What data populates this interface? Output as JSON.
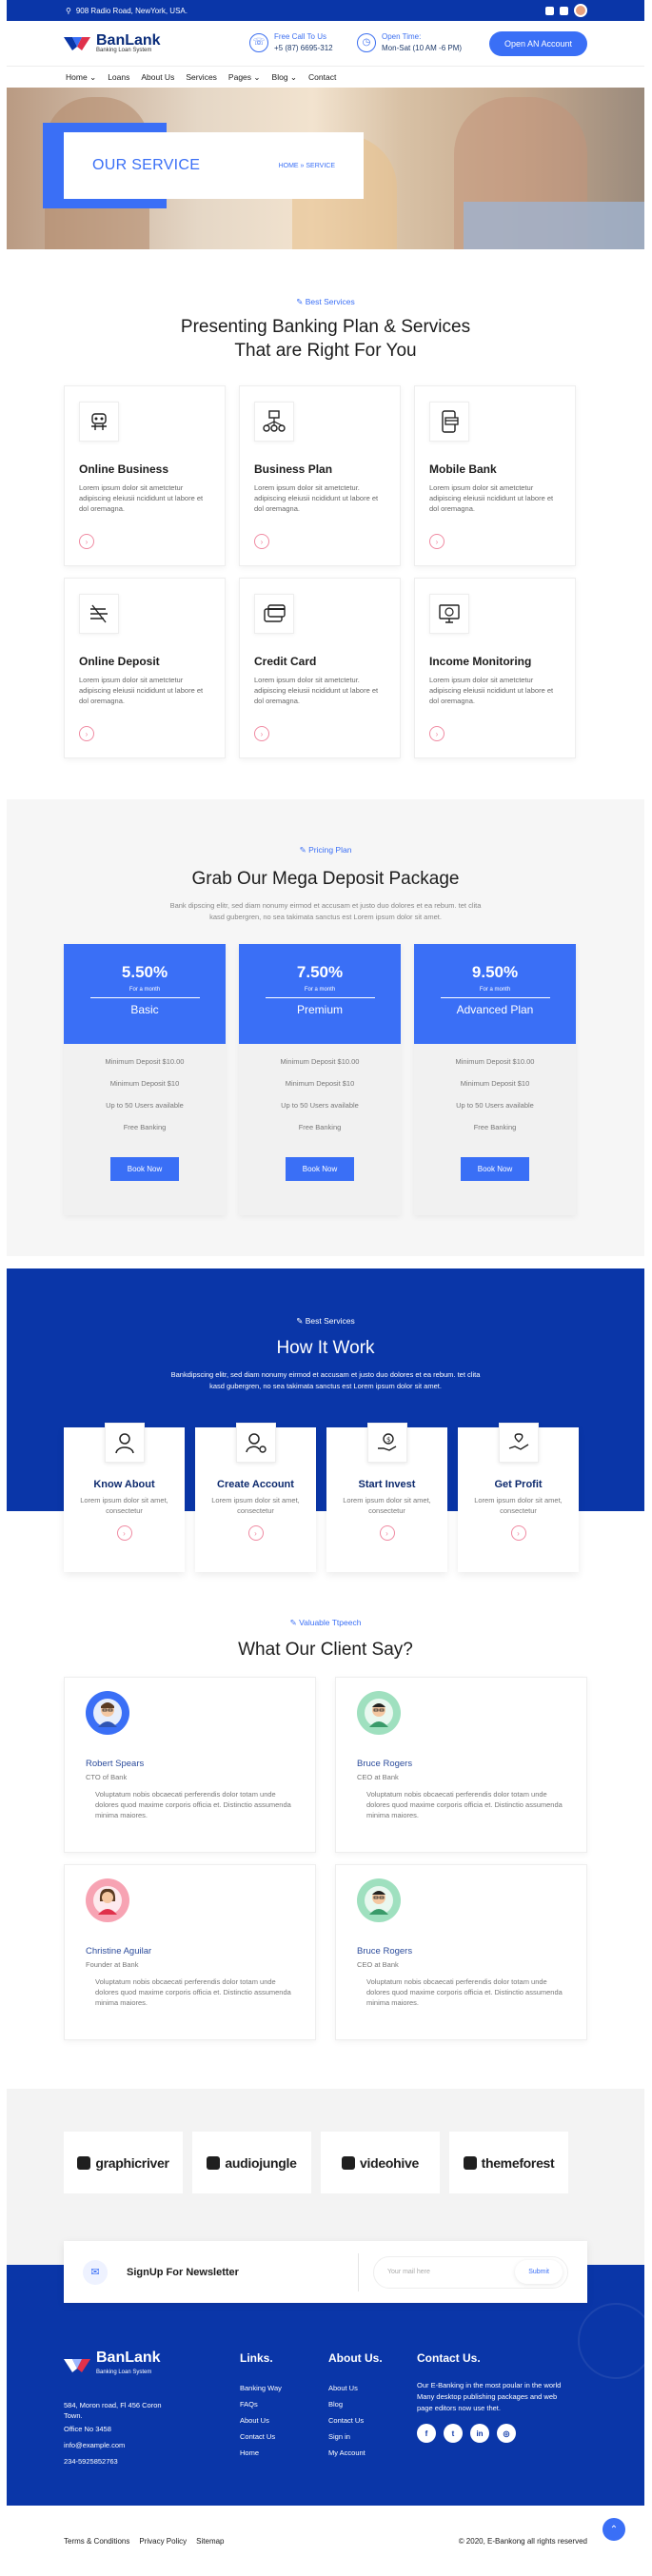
{
  "topbar": {
    "address": "908 Radio Road, NewYork, USA."
  },
  "brand": {
    "name": "BanLank",
    "tagline": "Banking Loan System"
  },
  "header": {
    "call_label": "Free Call To Us",
    "call_value": "+5 (87) 6695-312",
    "time_label": "Open Time:",
    "time_value": "Mon-Sat (10 AM -6 PM)",
    "cta": "Open AN Account"
  },
  "nav": {
    "items": [
      "Home",
      "Loans",
      "About Us",
      "Services",
      "Pages",
      "Blog",
      "Contact"
    ]
  },
  "hero": {
    "title": "OUR SERVICE",
    "crumb_home": "HOME",
    "crumb_sep": "»",
    "crumb_current": "SERVICE"
  },
  "services": {
    "tag": "Best Services",
    "title_line1": "Presenting Banking Plan & Services",
    "title_line2": "That are Right For You",
    "items": [
      {
        "title": "Online Business",
        "text": "Lorem ipsum dolor sit ametctetur adipiscing eleiusii ncididunt ut labore et dol oremagna.",
        "icon": "robot-icon"
      },
      {
        "title": "Business Plan",
        "text": "Lorem ipsum dolor sit ametctetur. adipiscing eleiusii ncididunt ut labore et dol oremagna.",
        "icon": "network-icon"
      },
      {
        "title": "Mobile Bank",
        "text": "Lorem ipsum dolor sit ametctetur adipiscing eleiusii ncididunt ut labore et dol oremagna.",
        "icon": "mobile-card-icon"
      },
      {
        "title": "Online Deposit",
        "text": "Lorem ipsum dolor sit ametctetur adipiscing eleiusii ncididunt ut labore et dol oremagna.",
        "icon": "deposit-icon"
      },
      {
        "title": "Credit Card",
        "text": "Lorem ipsum dolor sit ametctetur. adipiscing eleiusii ncididunt ut labore et dol oremagna.",
        "icon": "credit-card-icon"
      },
      {
        "title": "Income Monitoring",
        "text": "Lorem ipsum dolor sit ametctetur adipiscing eleiusii ncididunt ut labore et dol oremagna.",
        "icon": "monitor-dollar-icon"
      }
    ]
  },
  "pricing": {
    "tag": "Pricing Plan",
    "title": "Grab Our Mega Deposit Package",
    "desc_line1": "Bank dipscing elitr, sed diam nonumy eirmod et accusam et justo duo dolores et ea rebum. tet clita",
    "desc_line2": "kasd gubergren, no sea takimata sanctus est Lorem ipsum dolor sit amet.",
    "plans": [
      {
        "rate": "5.50%",
        "per": "For a month",
        "name": "Basic",
        "features": [
          "Minimum Deposit $10.00",
          "Minimum Deposit $10",
          "Up to 50 Users available",
          "Free Banking"
        ],
        "button": "Book Now"
      },
      {
        "rate": "7.50%",
        "per": "For a month",
        "name": "Premium",
        "features": [
          "Minimum Deposit $10.00",
          "Minimum Deposit $10",
          "Up to 50 Users available",
          "Free Banking"
        ],
        "button": "Book Now"
      },
      {
        "rate": "9.50%",
        "per": "For a month",
        "name": "Advanced Plan",
        "features": [
          "Minimum Deposit $10.00",
          "Minimum Deposit $10",
          "Up to 50 Users available",
          "Free Banking"
        ],
        "button": "Book Now"
      }
    ]
  },
  "how": {
    "tag": "Best Services",
    "title": "How It Work",
    "desc_line1": "Bankdipscing elitr, sed diam nonumy eirmod et accusam et justo duo dolores et ea rebum. tet clita",
    "desc_line2": "kasd gubergren, no sea takimata sanctus est Lorem ipsum dolor sit amet.",
    "steps": [
      {
        "title": "Know About",
        "text": "Lorem ipsum dolor sit amet, consectetur"
      },
      {
        "title": "Create Account",
        "text": "Lorem ipsum dolor sit amet, consectetur"
      },
      {
        "title": "Start Invest",
        "text": "Lorem ipsum dolor sit amet, consectetur"
      },
      {
        "title": "Get Profit",
        "text": "Lorem ipsum dolor sit amet, consectetur"
      }
    ]
  },
  "testimonials": {
    "tag": "Valuable Ttpeech",
    "title": "What Our Client Say?",
    "items": [
      {
        "name": "Robert Spears",
        "role": "CTO of Bank",
        "text": "Voluptatum nobis obcaecati perferendis dolor totam unde dolores quod maxime corporis officia et. Distinctio assumenda minima maiores."
      },
      {
        "name": "Bruce Rogers",
        "role": "CEO at Bank",
        "text": "Voluptatum nobis obcaecati perferendis dolor totam unde dolores quod maxime corporis officia et. Distinctio assumenda minima maiores."
      },
      {
        "name": "Christine Aguilar",
        "role": "Founder at Bank",
        "text": "Voluptatum nobis obcaecati perferendis dolor totam unde dolores quod maxime corporis officia et. Distinctio assumenda minima maiores."
      },
      {
        "name": "Bruce Rogers",
        "role": "CEO at Bank",
        "text": "Voluptatum nobis obcaecati perferendis dolor totam unde dolores quod maxime corporis officia et. Distinctio assumenda minima maiores."
      }
    ]
  },
  "partners": [
    "graphicriver",
    "audiojungle",
    "videohive",
    "themeforest"
  ],
  "newsletter": {
    "title": "SignUp For Newsletter",
    "placeholder": "Your mail here",
    "button": "Submit"
  },
  "footer": {
    "address_line1": "584, Moron road, Fl 456 Coron",
    "address_line2": "Town.",
    "office": "Office No 3458",
    "email": "info@example.com",
    "phone": "234-5925852763",
    "links_title": "Links.",
    "links": [
      "Banking Way",
      "FAQs",
      "About Us",
      "Contact Us",
      "Home"
    ],
    "about_title": "About Us.",
    "about_links": [
      "About Us",
      "Blog",
      "Contact Us",
      "Sign in",
      "My Account"
    ],
    "contact_title": "Contact Us.",
    "contact_text_1": "Our E-Banking in the most poular in the world",
    "contact_text_2": "Many desktop publishing packages and web",
    "contact_text_3": "page editors now use thet.",
    "social": [
      "f",
      "t",
      "in",
      "◎"
    ]
  },
  "bottom": {
    "links": [
      "Terms & Conditions",
      "Privacy Policy",
      "Sitemap"
    ],
    "copyright": "© 2020, E-Bankong all rights reserved"
  },
  "colors": {
    "primary": "#3a6ff6",
    "navy": "#0a36a8",
    "accent_pink": "#f08aa2"
  }
}
